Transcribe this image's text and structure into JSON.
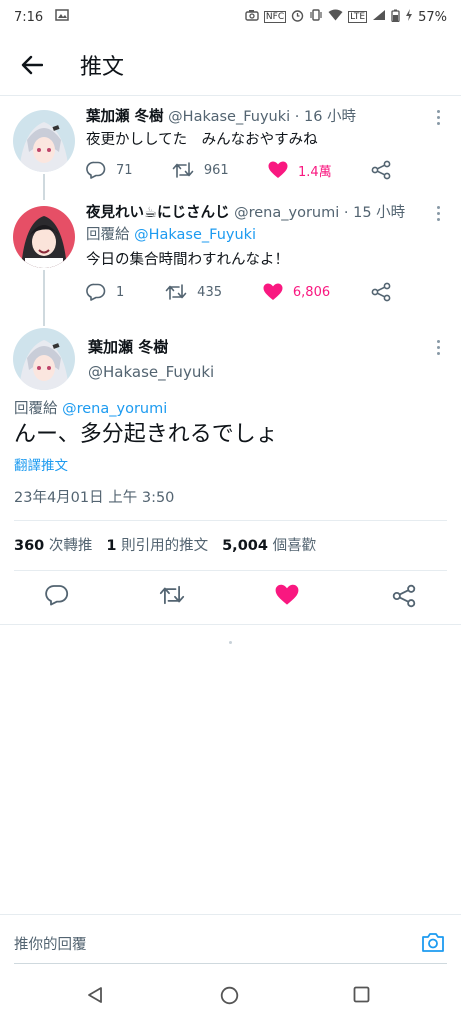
{
  "status_bar": {
    "time": "7:16",
    "battery": "57%"
  },
  "header": {
    "title": "推文"
  },
  "thread": [
    {
      "name": "葉加瀬 冬樹",
      "handle": "@Hakase_Fuyuki",
      "time": "· 16 小時",
      "text": "夜更かししてた　みんなおやすみね",
      "replies": "71",
      "retweets": "961",
      "likes": "1.4萬"
    },
    {
      "name": "夜見れい☕にじさんじ",
      "handle": "@rena_yorumi",
      "time": "· 15 小時",
      "reply_prefix": "回覆給",
      "reply_to": "@Hakase_Fuyuki",
      "text": "今日の集合時間わすれんなよ！",
      "replies": "1",
      "retweets": "435",
      "likes": "6,806"
    }
  ],
  "main_tweet": {
    "name": "葉加瀬 冬樹",
    "handle": "@Hakase_Fuyuki",
    "reply_prefix": "回覆給",
    "reply_to": "@rena_yorumi",
    "text": "んー、多分起きれるでしょ",
    "translate": "翻譯推文",
    "timestamp": "23年4月01日 上午 3:50",
    "retweet_count": "360",
    "retweet_label": "次轉推",
    "quote_count": "1",
    "quote_label": "則引用的推文",
    "like_count": "5,004",
    "like_label": "個喜歡"
  },
  "reply_bar": {
    "placeholder": "推你的回覆"
  },
  "colors": {
    "like": "#f91880",
    "link": "#1d9bf0",
    "secondary": "#536471"
  }
}
